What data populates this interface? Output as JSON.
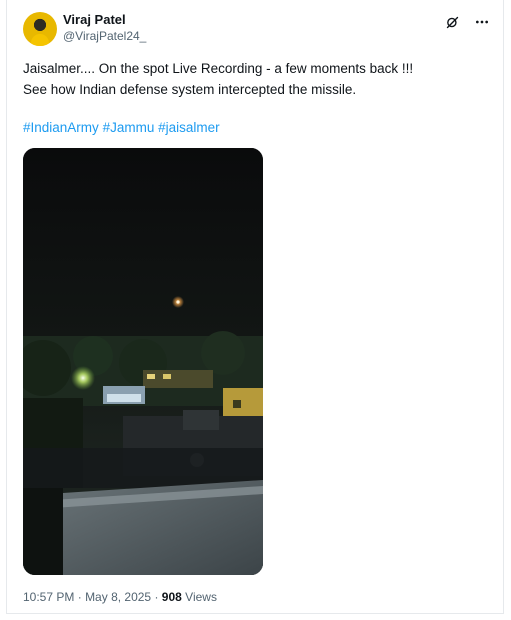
{
  "author": {
    "display_name": "Viraj Patel",
    "handle": "@VirajPatel24_"
  },
  "tweet": {
    "line1": "Jaisalmer.... On the spot Live Recording - a few moments back !!!",
    "line2": "See how Indian defense system intercepted the missile.",
    "hashtags": [
      "#IndianArmy",
      "#Jammu",
      "#jaisalmer"
    ]
  },
  "meta": {
    "time": "10:57 PM",
    "separator": "·",
    "date": "May 8, 2025",
    "views_count": "908",
    "views_label": "Views"
  },
  "icons": {
    "grok": "grok-icon",
    "more": "more-icon"
  },
  "colors": {
    "text": "#0f1419",
    "secondary": "#536471",
    "link": "#1d9bf0"
  }
}
